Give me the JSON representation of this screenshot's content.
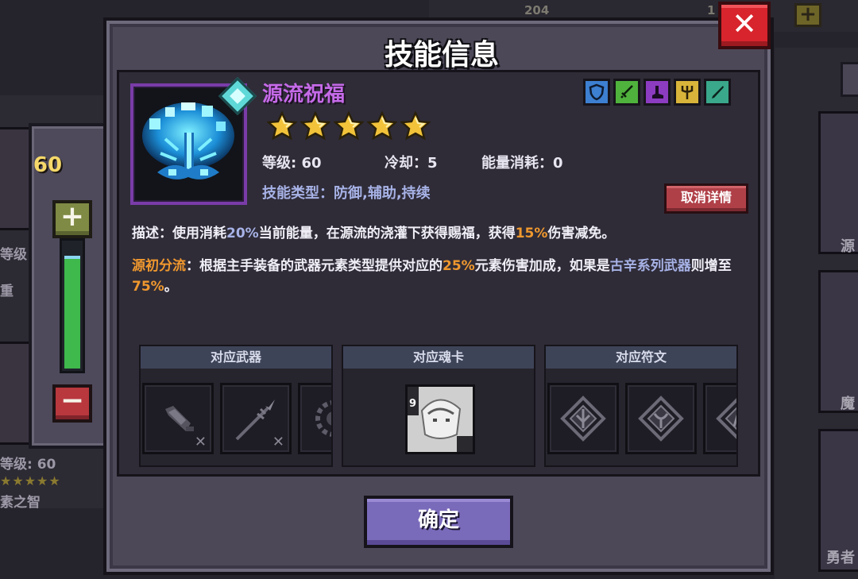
{
  "dialog": {
    "title": "技能信息",
    "close_icon": "close-icon"
  },
  "skill": {
    "name": "源流祝福",
    "stars": 5,
    "level_label": "等级: 60",
    "cooldown_label": "冷却：5",
    "energy_label": "能量消耗：0",
    "type_label": "技能类型：防御,辅助,持续",
    "detail_button": "取消详情",
    "tags": [
      {
        "icon": "shield-icon",
        "color": "#3d7fd0"
      },
      {
        "icon": "sword-icon",
        "color": "#4fb23c"
      },
      {
        "icon": "boot-icon",
        "color": "#8c3cc0"
      },
      {
        "icon": "trident-icon",
        "color": "#d8b43a"
      },
      {
        "icon": "blade-icon",
        "color": "#3aa88a"
      }
    ]
  },
  "description": {
    "p1_a": "描述：使用消耗",
    "p1_b": "20%",
    "p1_c": "当前能量，在源流的浇灌下获得赐福，获得",
    "p1_d": "15%",
    "p1_e": "伤害减免。",
    "p2_a": "源初分流",
    "p2_b": "：根据主手装备的武器元素类型提供对应的",
    "p2_c": "25%",
    "p2_d": "元素伤害加成，如果是",
    "p2_e": "古辛系列武器",
    "p2_f": "则增至",
    "p2_g": "75%",
    "p2_h": "。"
  },
  "sections": {
    "weapons": "对应武器",
    "soul_card": "对应魂卡",
    "runes": "对应符文",
    "card_cost": "9"
  },
  "level_panel": {
    "value": "60",
    "plus_label": "+",
    "minus_label": "−",
    "fill_fraction": 0.9
  },
  "background": {
    "top_count_1": "204",
    "top_count_2": "1",
    "left_text_1": "等级",
    "left_text_2": "重",
    "left_text_3": "等级: 60",
    "left_text_4": "素之智",
    "left_stars": "★★★★★",
    "right_text_1": "源",
    "right_text_2": "魔",
    "right_text_3": "勇者"
  },
  "ok_button": "确定",
  "colors": {
    "skill_name": "#c56ae8",
    "highlight_orange": "#f0982e",
    "highlight_purple": "#a7b2e6",
    "star": "#f2c33a"
  }
}
